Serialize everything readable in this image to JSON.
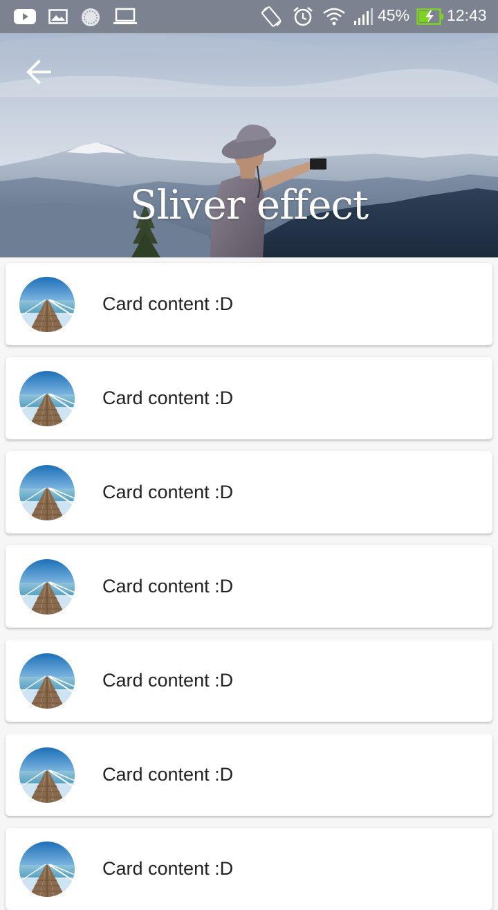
{
  "status_bar": {
    "battery_percent": "45%",
    "time": "12:43",
    "icons": [
      "youtube-icon",
      "image-icon",
      "sync-icon",
      "laptop-icon",
      "rotate-icon",
      "alarm-icon",
      "wifi-icon",
      "signal-icon",
      "battery-charging-icon"
    ]
  },
  "header": {
    "title": "Sliver effect",
    "back_icon": "arrow-back-icon"
  },
  "cards": [
    {
      "text": "Card content :D",
      "avatar": "pier-avatar"
    },
    {
      "text": "Card content :D",
      "avatar": "pier-avatar"
    },
    {
      "text": "Card content :D",
      "avatar": "pier-avatar"
    },
    {
      "text": "Card content :D",
      "avatar": "pier-avatar"
    },
    {
      "text": "Card content :D",
      "avatar": "pier-avatar"
    },
    {
      "text": "Card content :D",
      "avatar": "pier-avatar"
    },
    {
      "text": "Card content :D",
      "avatar": "pier-avatar"
    }
  ],
  "colors": {
    "status_bar": "#787e8a",
    "card_background": "#ffffff",
    "page_background": "#f6f6f6",
    "battery_accent": "#7ed321"
  }
}
